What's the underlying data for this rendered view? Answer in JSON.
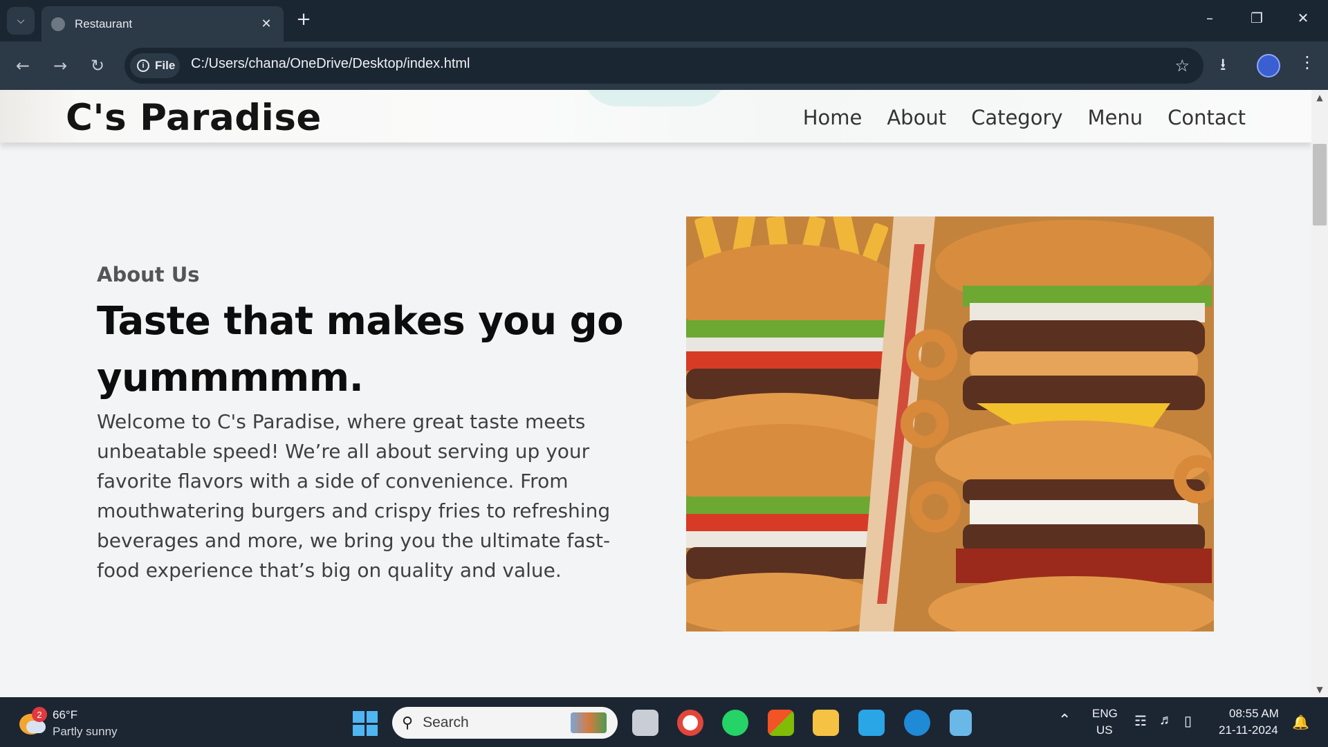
{
  "browser": {
    "tab_title": "Restaurant",
    "address_chip": "File",
    "url": "C:/Users/chana/OneDrive/Desktop/index.html"
  },
  "site": {
    "brand": "C's Paradise",
    "nav": [
      "Home",
      "About",
      "Category",
      "Menu",
      "Contact"
    ],
    "about": {
      "kicker": "About Us",
      "heading": "Taste that makes you go yummmmm.",
      "body": "Welcome to C's Paradise, where great taste meets unbeatable speed! We’re all about serving up your favorite flavors with a side of convenience. From mouthwatering burgers and crispy fries to refreshing beverages and more, we bring you the ultimate fast-food experience that’s big on quality and value."
    }
  },
  "taskbar": {
    "weather_temp": "66°F",
    "weather_desc": "Partly sunny",
    "weather_badge": "2",
    "search_label": "Search",
    "lang_line1": "ENG",
    "lang_line2": "US",
    "time": "08:55 AM",
    "date": "21-11-2024"
  },
  "colors": {
    "chrome_dark": "#1b2633",
    "chrome_mid": "#2c3947",
    "page_bg": "#f3f4f6",
    "brand_text": "#141414"
  }
}
